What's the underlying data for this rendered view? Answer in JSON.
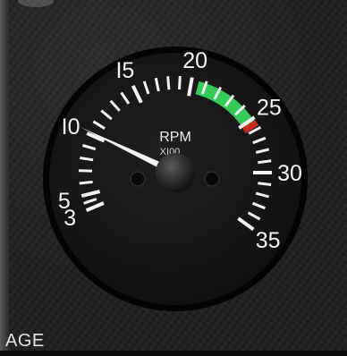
{
  "gauge": {
    "title": "RPM",
    "subtitle": "XI00",
    "numerals": [
      {
        "text": "3",
        "value": 3
      },
      {
        "text": "5",
        "value": 5
      },
      {
        "text": "I0",
        "value": 10
      },
      {
        "text": "I5",
        "value": 15
      },
      {
        "text": "20",
        "value": 20
      },
      {
        "text": "25",
        "value": 25
      },
      {
        "text": "30",
        "value": 30
      },
      {
        "text": "35",
        "value": 35
      }
    ],
    "scale_min": 3,
    "scale_max": 35,
    "needle_value": 10.2,
    "green_arc": [
      20.5,
      25.3
    ],
    "red_line": 25.5
  },
  "panel_label": "AGE",
  "colors": {
    "face": "#141414",
    "bezel": "#050505",
    "ticks": "#f2f2f2",
    "green": "#33cc55",
    "red": "#cc2a1a",
    "needle": "#f4f4f4"
  }
}
